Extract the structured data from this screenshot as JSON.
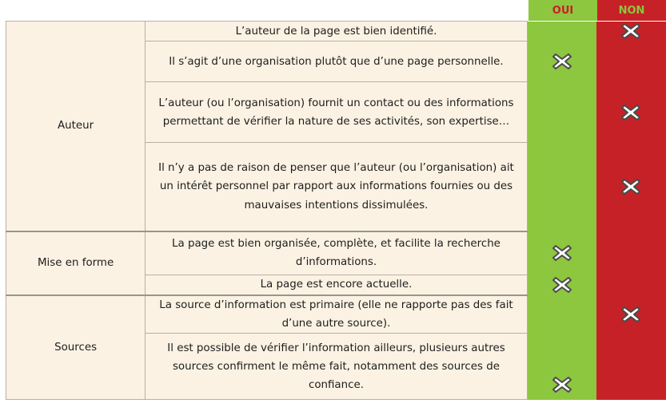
{
  "header": {
    "oui": "OUI",
    "non": "NON"
  },
  "colors": {
    "oui": "#8dc63f",
    "non": "#c62127",
    "row_bg": "#fbf2e3",
    "mark": "#ffffff",
    "mark_outline": "#4a4a4a"
  },
  "groups": [
    {
      "category": "Auteur",
      "rows": [
        {
          "criterion": "L’auteur de la page est bien identifié.",
          "mark": "non"
        },
        {
          "criterion": "Il s’agit d’une organisation plutôt que d’une page personnelle.",
          "mark": "oui"
        },
        {
          "criterion": "L’auteur (ou l’organisation) fournit un contact ou des informations permettant de vérifier la nature de ses activités, son expertise…",
          "mark": "non"
        },
        {
          "criterion": "Il n’y a pas de raison de penser que l’auteur (ou l’organisation) ait un intérêt personnel par rapport aux informations fournies ou des mauvaises intentions dissimulées.",
          "mark": "non"
        }
      ]
    },
    {
      "category": "Mise en forme",
      "rows": [
        {
          "criterion": "La page est bien organisée, complète, et facilite la recherche d’informations.",
          "mark": "oui"
        },
        {
          "criterion": "La page est encore actuelle.",
          "mark": "oui"
        }
      ]
    },
    {
      "category": "Sources",
      "rows": [
        {
          "criterion": "La source d’information est primaire (elle ne rapporte pas des fait d’une autre source).",
          "mark": "non"
        },
        {
          "criterion": "Il est possible de vérifier l’information ailleurs, plusieurs autres sources confirment le même fait, notamment des sources de confiance.",
          "mark": "oui"
        }
      ]
    }
  ]
}
